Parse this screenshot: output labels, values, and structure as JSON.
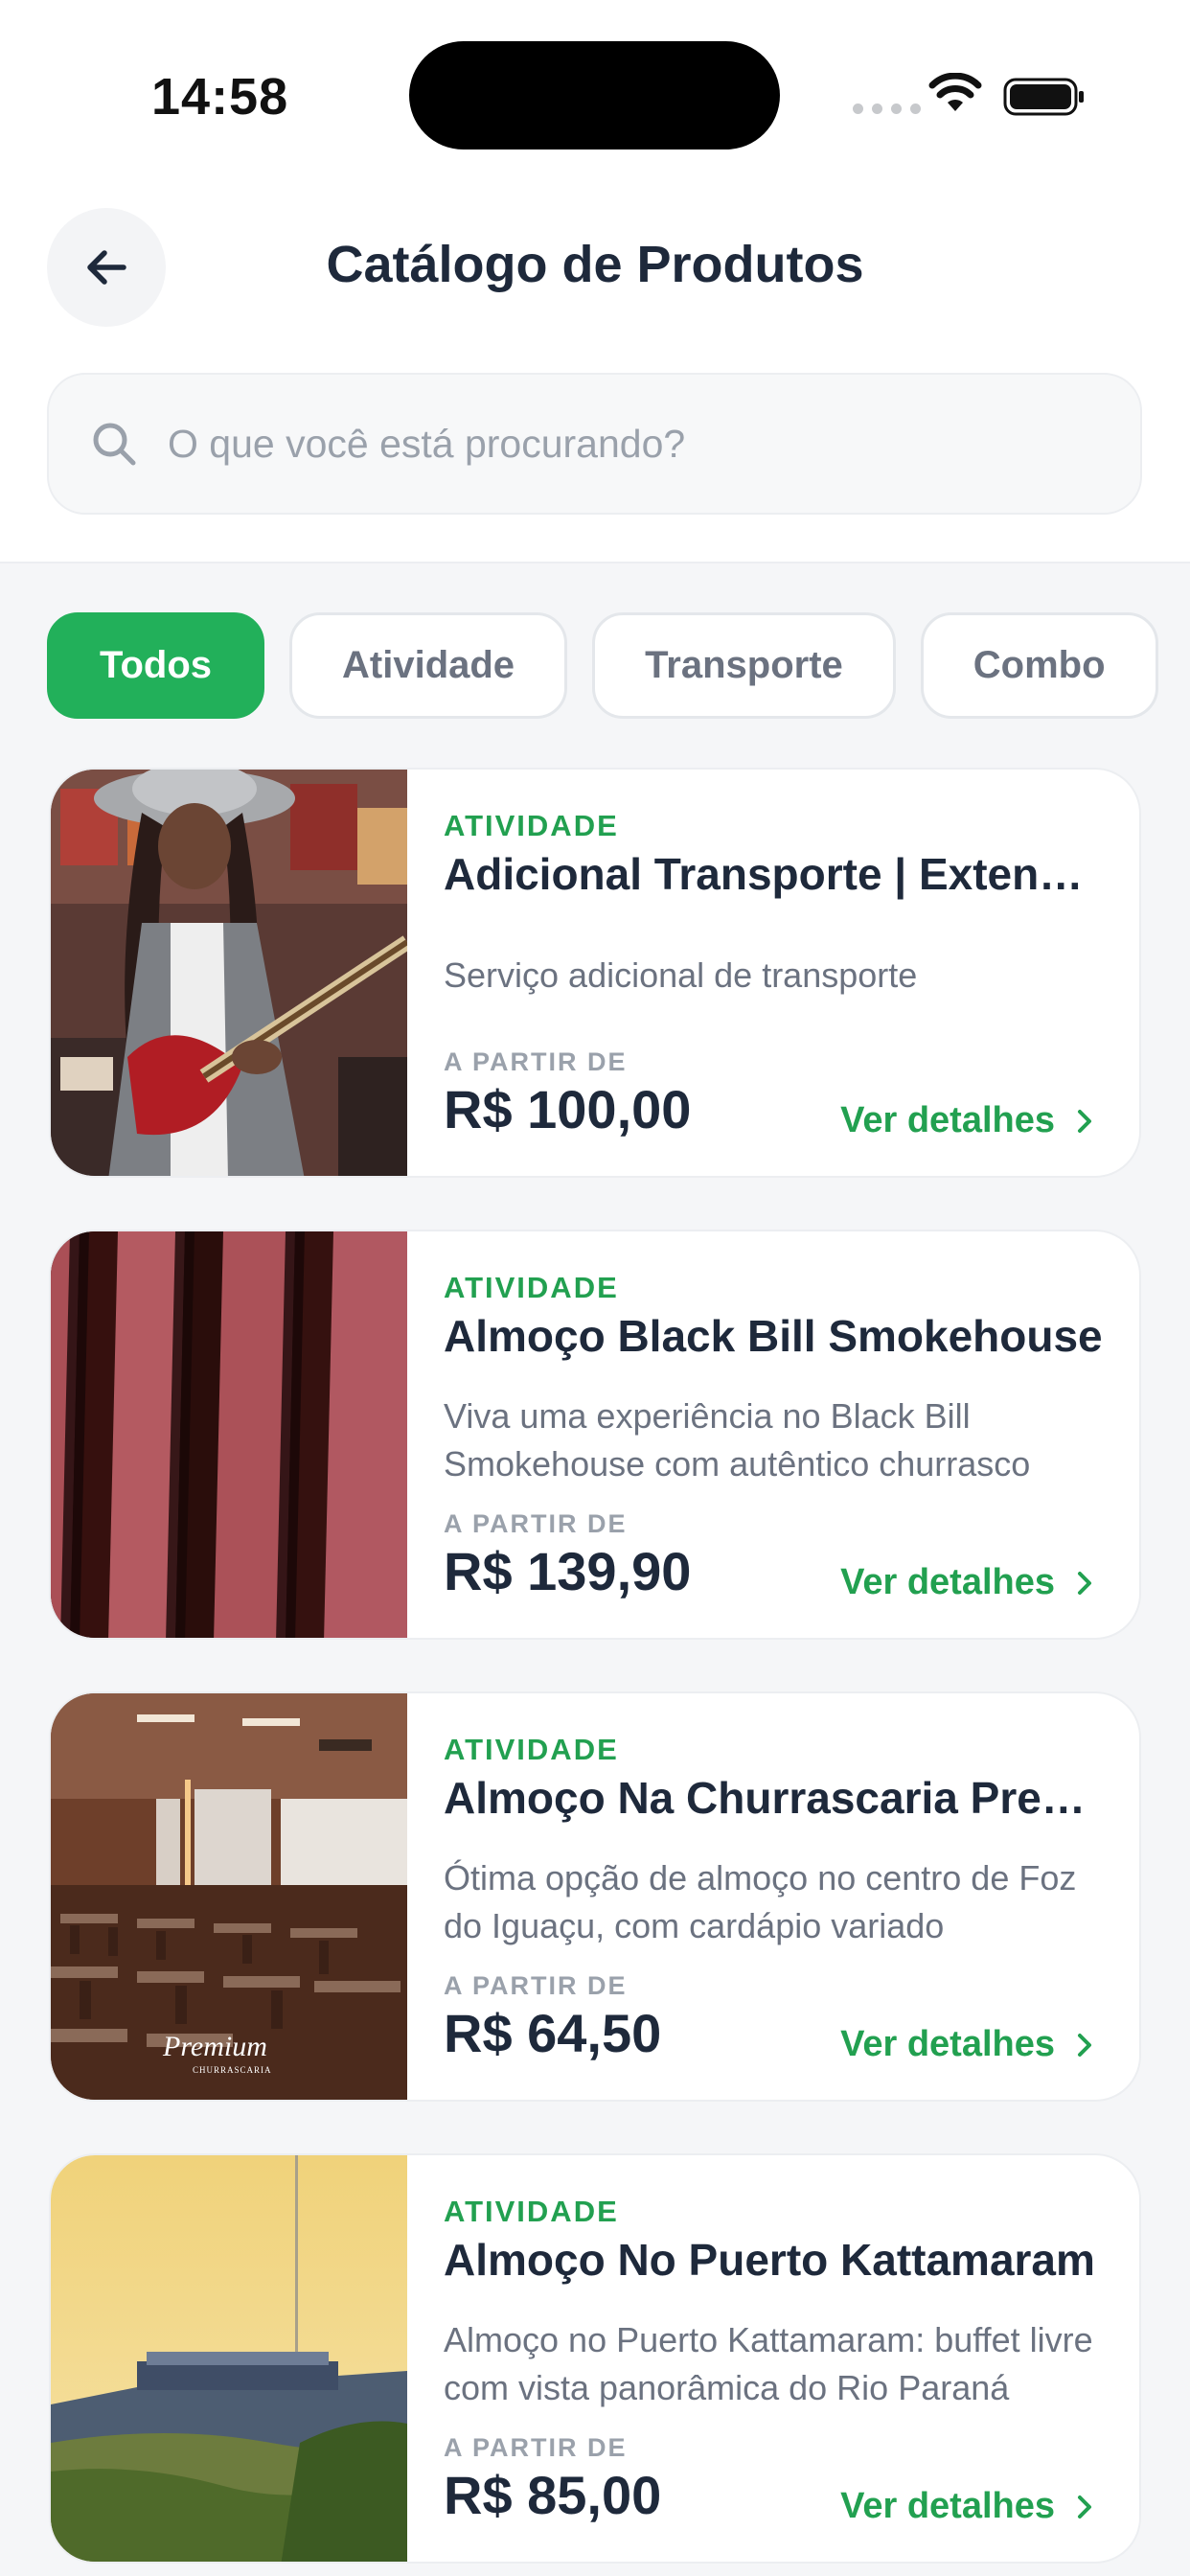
{
  "status_bar": {
    "time": "14:58"
  },
  "header": {
    "title": "Catálogo de Produtos",
    "search_placeholder": "O que você está procurando?"
  },
  "chips": [
    {
      "label": "Todos",
      "active": true
    },
    {
      "label": "Atividade",
      "active": false
    },
    {
      "label": "Transporte",
      "active": false
    },
    {
      "label": "Combo",
      "active": false
    }
  ],
  "products": [
    {
      "category": "ATIVIDADE",
      "title": "Adicional Transporte | Extensão",
      "description": "Serviço adicional de transporte",
      "price_prefix": "A PARTIR DE",
      "price": "R$ 100,00",
      "link_label": "Ver detalhes",
      "image": "woman-playing-guitar-photo"
    },
    {
      "category": "ATIVIDADE",
      "title": "Almoço Black Bill Smokehouse",
      "description": "Viva uma experiência no Black Bill Smokehouse com autêntico churrasco",
      "price_prefix": "A PARTIR DE",
      "price": "R$ 139,90",
      "link_label": "Ver detalhes",
      "image": "sliced-brisket-photo"
    },
    {
      "category": "ATIVIDADE",
      "title": "Almoço Na Churrascaria Premium",
      "description": "Ótima opção de almoço no centro de Foz do Iguaçu, com cardápio variado",
      "price_prefix": "A PARTIR DE",
      "price": "R$ 64,50",
      "link_label": "Ver detalhes",
      "image": "restaurant-dining-room-photo",
      "image_logo": {
        "script": "Premium",
        "caption": "CHURRASCARIA"
      }
    },
    {
      "category": "ATIVIDADE",
      "title": "Almoço No Puerto Kattamaram",
      "description": "Almoço no Puerto Kattamaram: buffet livre com vista panorâmica do Rio Paraná",
      "price_prefix": "A PARTIR DE",
      "price": "R$ 85,00",
      "link_label": "Ver detalhes",
      "image": "riverside-venue-photo"
    }
  ],
  "colors": {
    "accent": "#22b05a",
    "accent_text": "#22a050",
    "title": "#1e293b",
    "muted": "#6b7280"
  }
}
